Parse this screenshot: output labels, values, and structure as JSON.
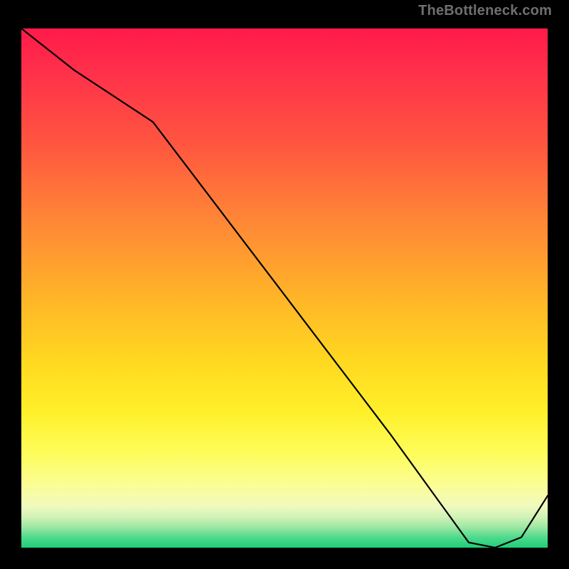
{
  "attribution": "TheBottleneck.com",
  "chart_data": {
    "type": "line",
    "title": "",
    "xlabel": "",
    "ylabel": "",
    "xlim": [
      0,
      100
    ],
    "ylim": [
      0,
      100
    ],
    "x": [
      0,
      10,
      25,
      40,
      55,
      70,
      80,
      85,
      90,
      95,
      100
    ],
    "values": [
      100,
      92,
      82,
      62,
      42,
      22,
      8,
      1,
      0,
      2,
      10
    ],
    "gradient_stops": [
      {
        "pct": 0,
        "color": "#ff1a4a"
      },
      {
        "pct": 22,
        "color": "#ff5540"
      },
      {
        "pct": 52,
        "color": "#ffb528"
      },
      {
        "pct": 74,
        "color": "#fff02a"
      },
      {
        "pct": 92,
        "color": "#f0fabe"
      },
      {
        "pct": 98,
        "color": "#4fd98c"
      },
      {
        "pct": 100,
        "color": "#1ecf79"
      }
    ],
    "annotation": {
      "text": "",
      "x": 84,
      "y": 1
    }
  }
}
